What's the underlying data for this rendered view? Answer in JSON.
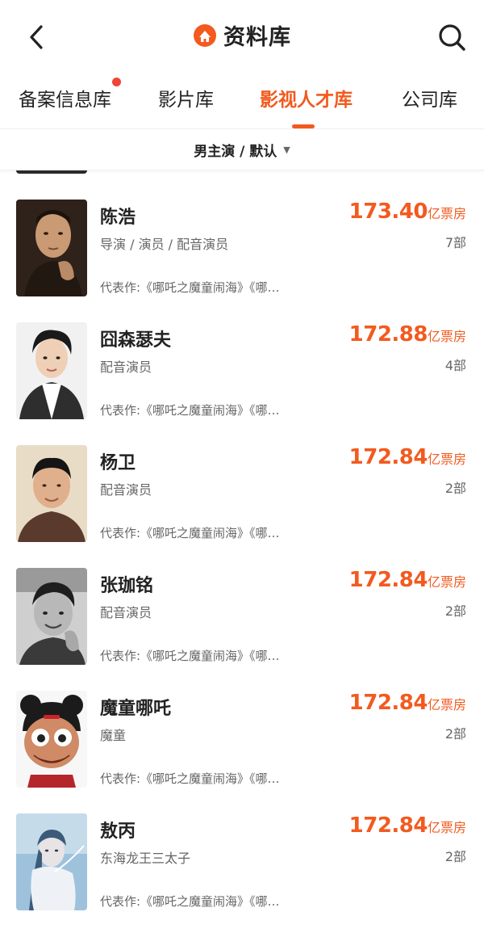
{
  "header": {
    "title": "资料库",
    "logo_color": "#f25a1f"
  },
  "tabs": [
    {
      "label": "备案信息库",
      "active": false,
      "has_dot": true
    },
    {
      "label": "影片库",
      "active": false
    },
    {
      "label": "影视人才库",
      "active": true
    },
    {
      "label": "公司库",
      "active": false
    }
  ],
  "filter": {
    "label": "男主演 / 默认",
    "caret": "▼"
  },
  "accent_color": "#f25a1f",
  "people": [
    {
      "name": "陈浩",
      "role": "导演 / 演员 / 配音演员",
      "box": "173.40",
      "unit": "亿票房",
      "count": "7部",
      "works": "代表作:《哪吒之魔童闹海》《哪…",
      "avatar": "portrait-man-dark"
    },
    {
      "name": "囧森瑟夫",
      "role": "配音演员",
      "box": "172.88",
      "unit": "亿票房",
      "count": "4部",
      "works": "代表作:《哪吒之魔童闹海》《哪…",
      "avatar": "portrait-man-white"
    },
    {
      "name": "杨卫",
      "role": "配音演员",
      "box": "172.84",
      "unit": "亿票房",
      "count": "2部",
      "works": "代表作:《哪吒之魔童闹海》《哪…",
      "avatar": "portrait-older-man"
    },
    {
      "name": "张珈铭",
      "role": "配音演员",
      "box": "172.84",
      "unit": "亿票房",
      "count": "2部",
      "works": "代表作:《哪吒之魔童闹海》《哪…",
      "avatar": "portrait-man-bw"
    },
    {
      "name": "魔童哪吒",
      "role": "魔童",
      "box": "172.84",
      "unit": "亿票房",
      "count": "2部",
      "works": "代表作:《哪吒之魔童闹海》《哪…",
      "avatar": "cartoon-nezha"
    },
    {
      "name": "敖丙",
      "role": "东海龙王三太子",
      "box": "172.84",
      "unit": "亿票房",
      "count": "2部",
      "works": "代表作:《哪吒之魔童闹海》《哪…",
      "avatar": "cartoon-aobing"
    }
  ]
}
